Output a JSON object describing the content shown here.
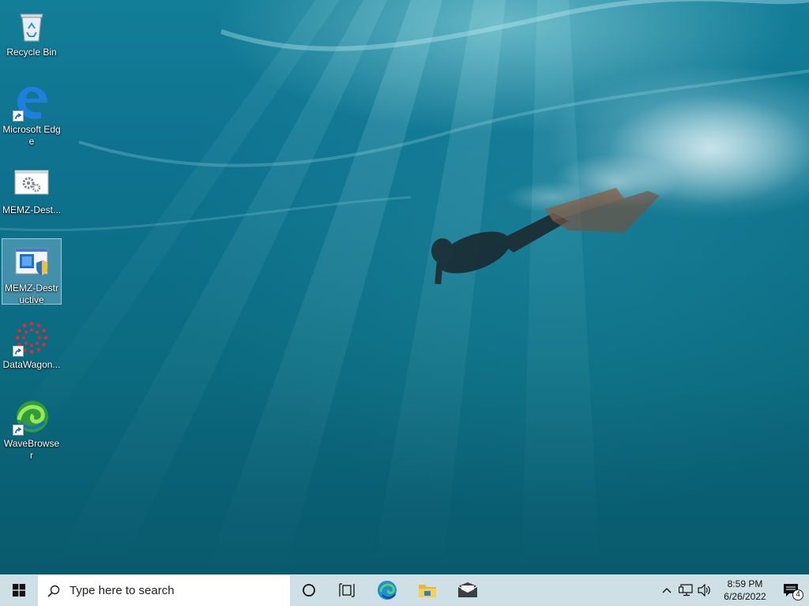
{
  "desktop": {
    "icons": [
      {
        "label": "Recycle Bin",
        "icon": "recycle-bin-icon"
      },
      {
        "label": "Microsoft Edge",
        "icon": "edge-legacy-icon"
      },
      {
        "label": "MEMZ-Dest...",
        "icon": "gears-window-icon"
      },
      {
        "label": "MEMZ-Destructive",
        "icon": "installer-shield-icon"
      },
      {
        "label": "DataWagon...",
        "icon": "red-dots-circle-icon"
      },
      {
        "label": "WaveBrowser",
        "icon": "wavebrowser-icon"
      }
    ],
    "selected_index": 3
  },
  "taskbar": {
    "search_placeholder": "Type here to search",
    "pinned": [
      "cortana-icon",
      "task-view-icon",
      "edge-icon",
      "file-explorer-icon",
      "mail-icon"
    ],
    "tray": {
      "time": "8:59 PM",
      "date": "6/26/2022",
      "notification_count": "4"
    }
  },
  "colors": {
    "taskbar_bg": "#cfdfe6",
    "selection": "#bee1ff",
    "windows_blue": "#0078d7"
  }
}
